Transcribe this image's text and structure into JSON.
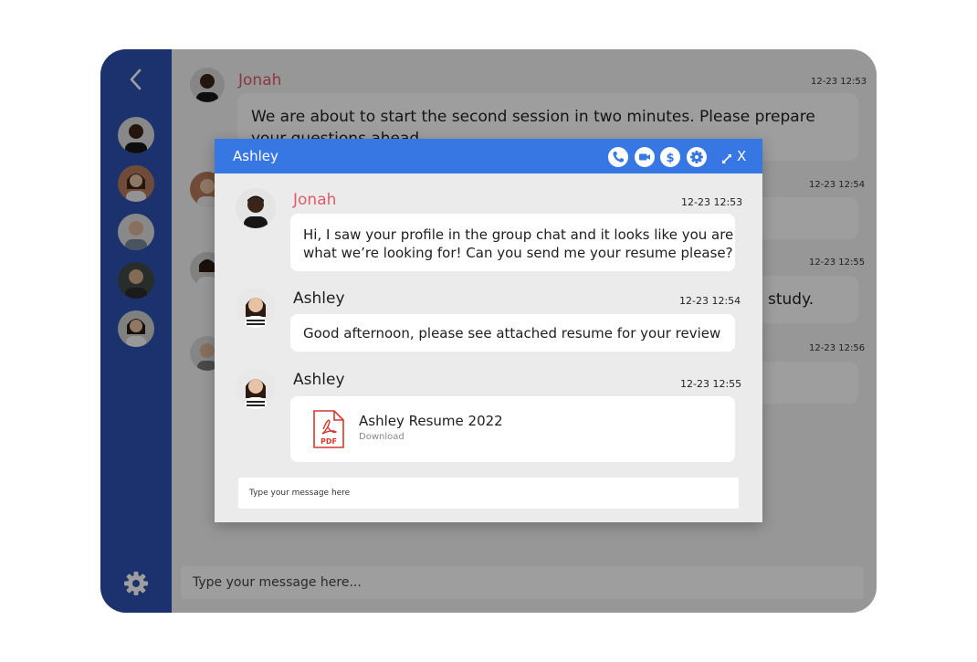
{
  "main": {
    "messages": [
      {
        "name": "Jonah",
        "time": "12-23 12:53",
        "text_line1": "We are about to start the second session in two minutes. Please prepare",
        "text_line2": "your questions ahead."
      },
      {
        "time": "12-23 12:54"
      },
      {
        "time": "12-23 12:55",
        "text": "study."
      },
      {
        "time": "12-23 12:56"
      }
    ],
    "input_placeholder": "Type your message here..."
  },
  "modal": {
    "title": "Ashley",
    "close_label": "X",
    "messages": [
      {
        "name": "Jonah",
        "time": "12-23 12:53",
        "text_line1": "Hi, I saw your profile in the group chat and it looks like you are",
        "text_line2": "what we’re looking for! Can you send me your resume please?"
      },
      {
        "name": "Ashley",
        "time": "12-23 12:54",
        "text": "Good afternoon, please see attached resume for your review"
      },
      {
        "name": "Ashley",
        "time": "12-23 12:55",
        "file_name": "Ashley Resume 2022",
        "file_action": "Download",
        "file_badge": "PDF"
      }
    ],
    "input_placeholder": "Type your message here"
  },
  "colors": {
    "sidebar": "#2c52b2",
    "header": "#3677e3",
    "accent_name": "#e05a6a",
    "pdf_red": "#d9362e"
  },
  "icons": [
    "back-chevron-icon",
    "settings-gear-icon",
    "phone-icon",
    "video-icon",
    "dollar-icon",
    "gear-icon",
    "expand-icon",
    "pdf-file-icon"
  ]
}
